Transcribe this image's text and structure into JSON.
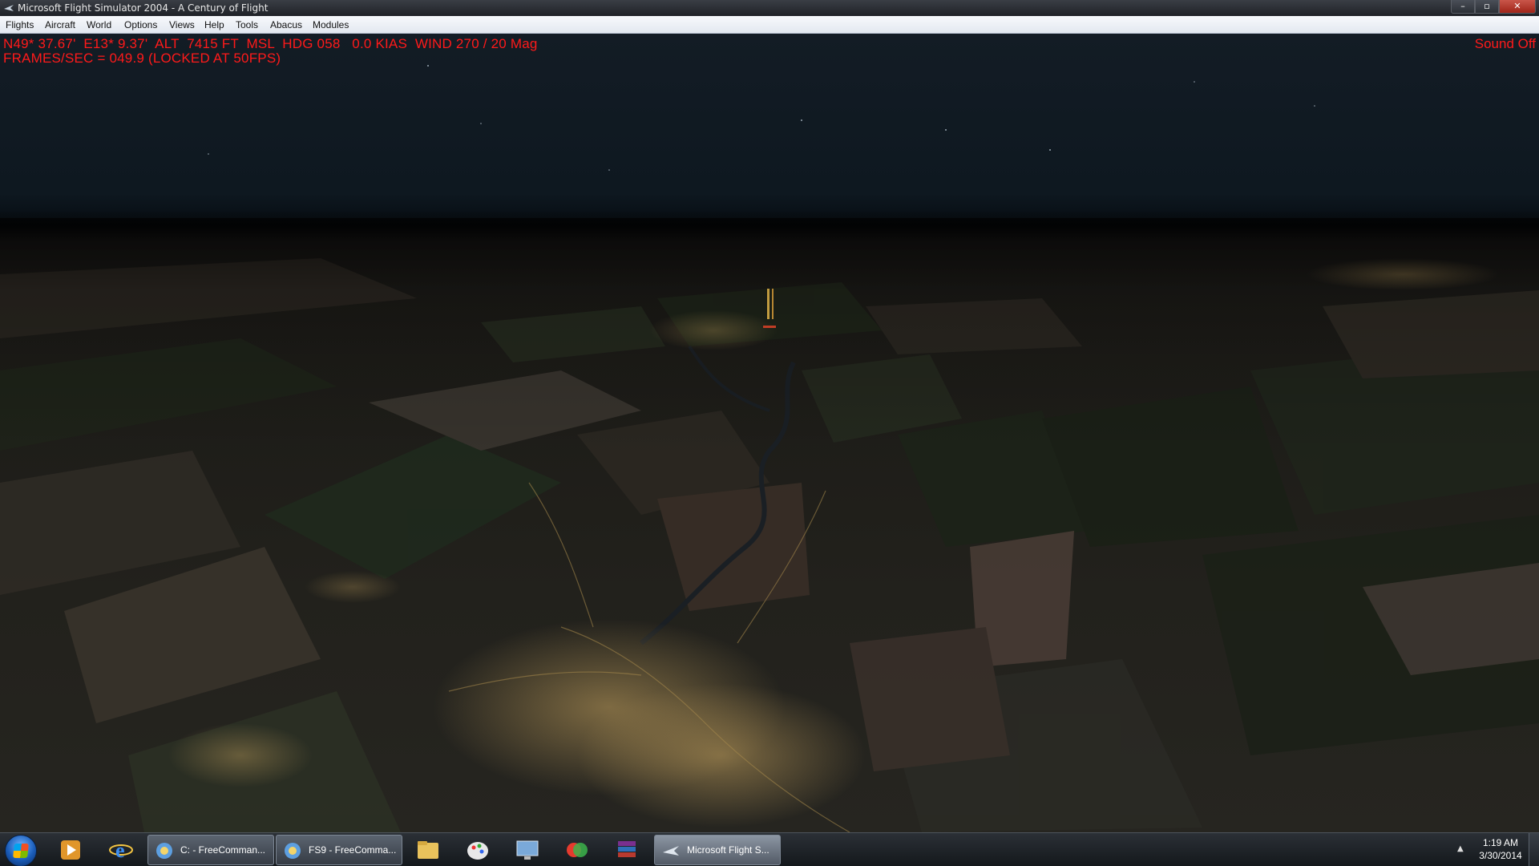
{
  "window": {
    "title": "Microsoft Flight Simulator 2004 - A Century of Flight",
    "app_icon": "flight-sim-icon",
    "controls": {
      "minimize": "–",
      "maximize": "▫",
      "close": "✕"
    }
  },
  "menu": [
    {
      "label": "Flights"
    },
    {
      "label": "Aircraft"
    },
    {
      "label": "World"
    },
    {
      "label": "Options"
    },
    {
      "label": "Views"
    },
    {
      "label": "Help"
    },
    {
      "label": "Tools"
    },
    {
      "label": "Abacus"
    },
    {
      "label": "Modules"
    }
  ],
  "hud": {
    "coords": "N49* 37.67'  E13* 9.37'  ALT  7415 FT  MSL  HDG 058   0.0 KIAS  WIND 270 / 20 Mag",
    "fps": "FRAMES/SEC = 049.9 (LOCKED AT 50FPS)",
    "sound": "Sound Off",
    "color": "#ff1a1a"
  },
  "taskbar": {
    "start_icon": "windows-start-icon",
    "pinned": [
      {
        "icon": "media-player-icon"
      },
      {
        "icon": "internet-explorer-icon"
      }
    ],
    "tasks": [
      {
        "label": "C: - FreeComman...",
        "icon": "freecommander-icon",
        "active": false
      },
      {
        "label": "FS9 - FreeComma...",
        "icon": "freecommander-icon",
        "active": false
      }
    ],
    "pinned_after": [
      {
        "icon": "file-explorer-icon"
      },
      {
        "icon": "paint-icon"
      },
      {
        "icon": "remote-desktop-icon"
      },
      {
        "icon": "color-tool-icon"
      },
      {
        "icon": "winrar-icon"
      }
    ],
    "active_task": {
      "label": "Microsoft Flight S...",
      "icon": "airplane-icon",
      "active": true
    },
    "tray_arrow": "▲",
    "clock": {
      "time": "1:19 AM",
      "date": "3/30/2014"
    }
  }
}
